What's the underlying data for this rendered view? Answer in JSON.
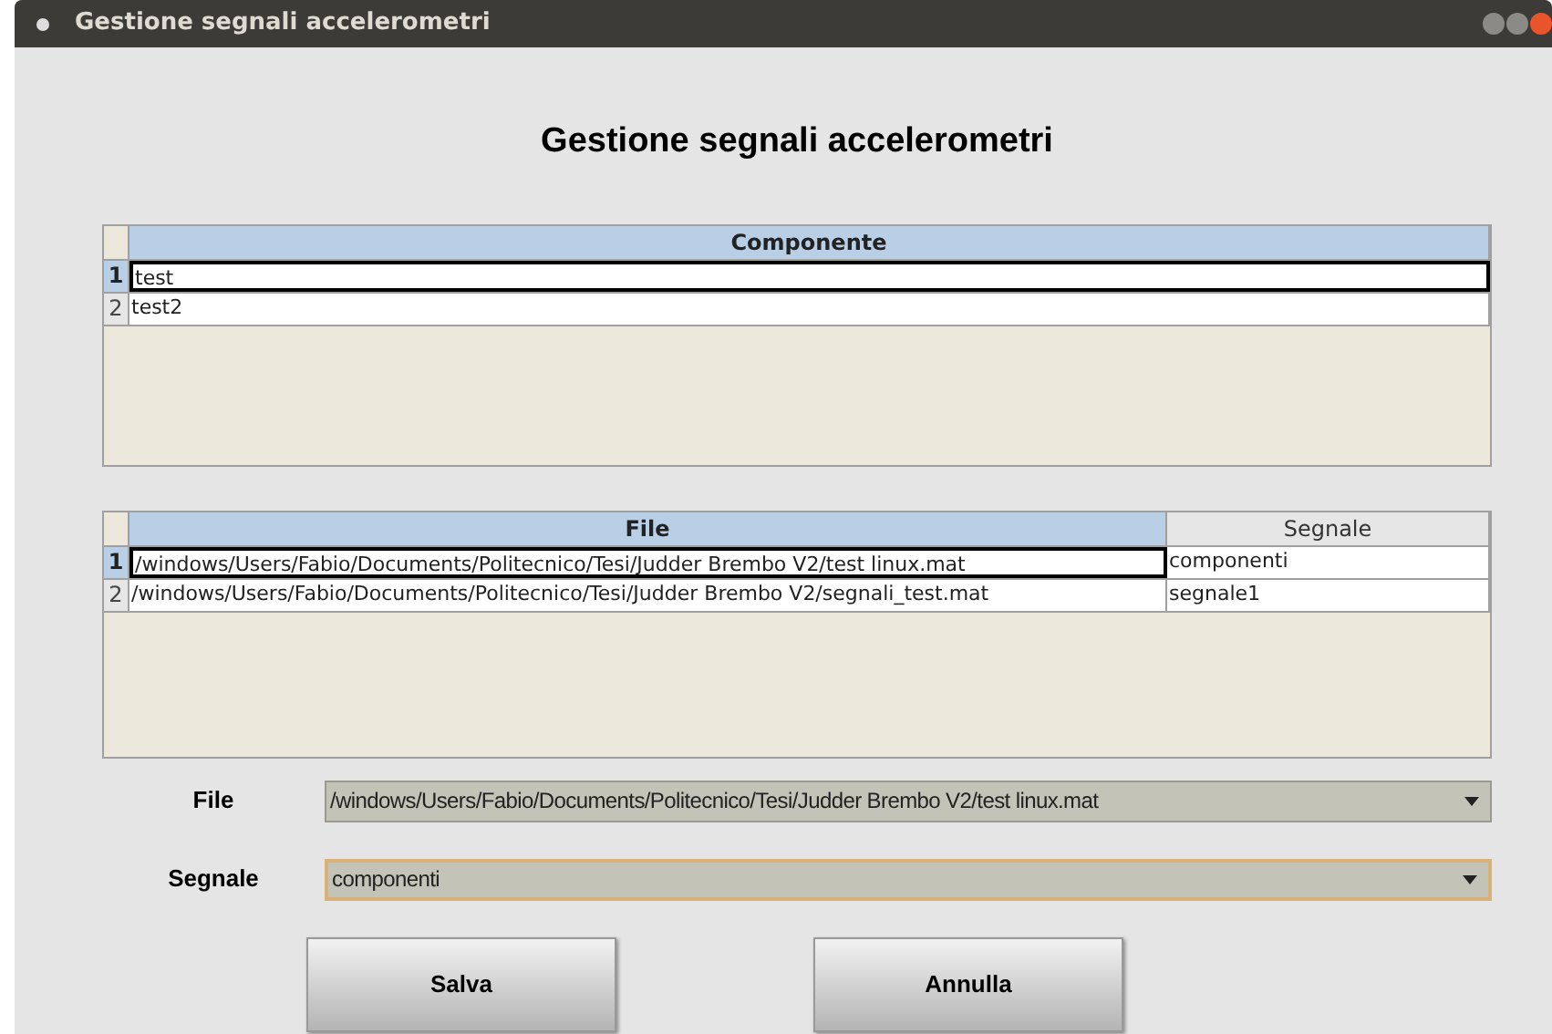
{
  "window": {
    "title": "Gestione segnali accelerometri"
  },
  "heading": "Gestione segnali accelerometri",
  "components_table": {
    "columns": [
      "Componente"
    ],
    "rows": [
      {
        "number": "1",
        "cells": [
          "test"
        ],
        "selected": true
      },
      {
        "number": "2",
        "cells": [
          "test2"
        ],
        "selected": false
      }
    ]
  },
  "files_table": {
    "columns": [
      {
        "label": "File",
        "selected": true
      },
      {
        "label": "Segnale",
        "selected": false
      }
    ],
    "rows": [
      {
        "number": "1",
        "cells": [
          "/windows/Users/Fabio/Documents/Politecnico/Tesi/Judder Brembo V2/test linux.mat",
          "componenti"
        ],
        "selected": true
      },
      {
        "number": "2",
        "cells": [
          "/windows/Users/Fabio/Documents/Politecnico/Tesi/Judder Brembo V2/segnali_test.mat",
          "segnale1"
        ],
        "selected": false
      }
    ]
  },
  "fields": [
    {
      "label": "File",
      "value": "/windows/Users/Fabio/Documents/Politecnico/Tesi/Judder Brembo V2/test linux.mat",
      "focused": false
    },
    {
      "label": "Segnale",
      "value": "componenti",
      "focused": true
    }
  ],
  "buttons": [
    "Salva",
    "Annulla"
  ]
}
